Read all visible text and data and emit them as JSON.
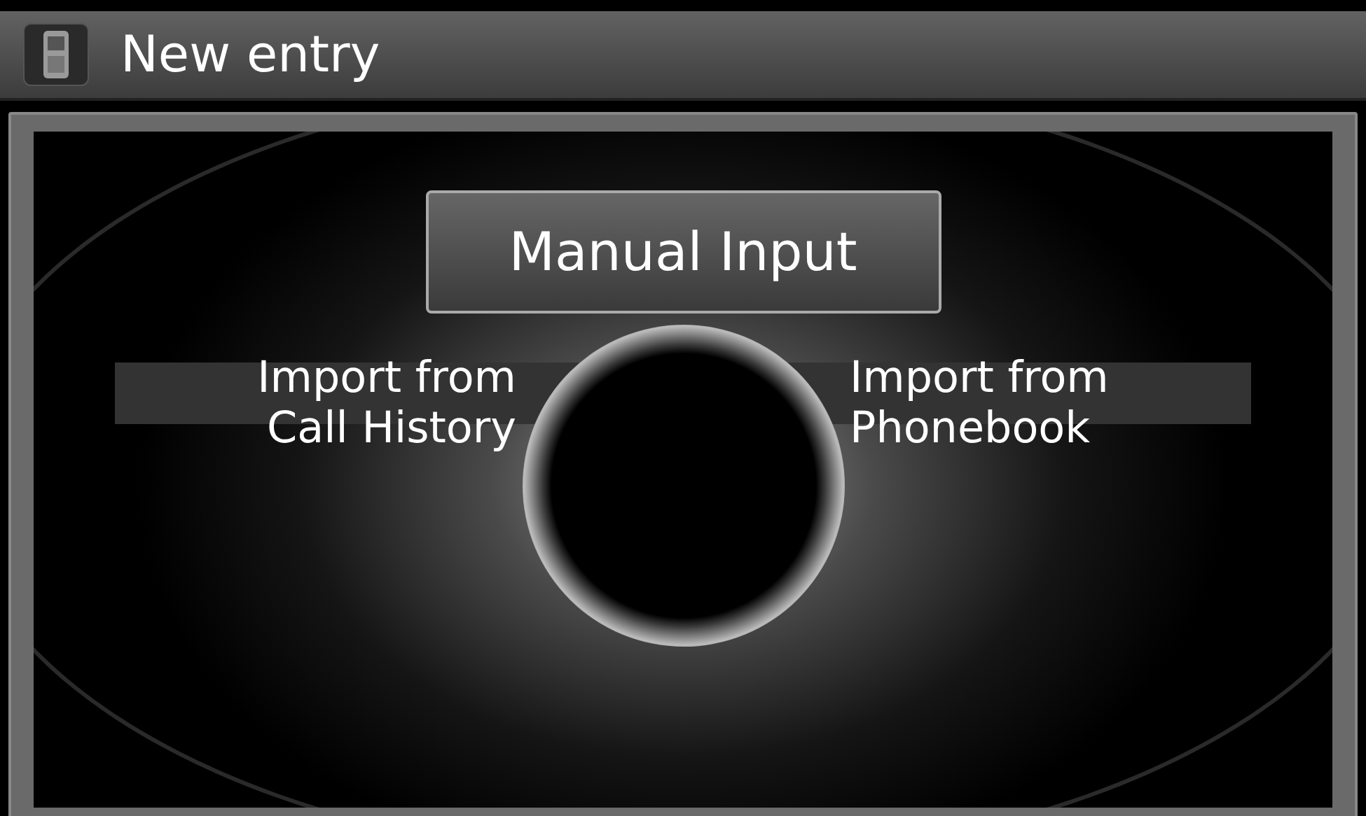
{
  "title": "New entry",
  "top_option": {
    "label": "Manual Input"
  },
  "left_option": {
    "label": "Import from\nCall History"
  },
  "right_option": {
    "label": "Import from\nPhonebook"
  }
}
